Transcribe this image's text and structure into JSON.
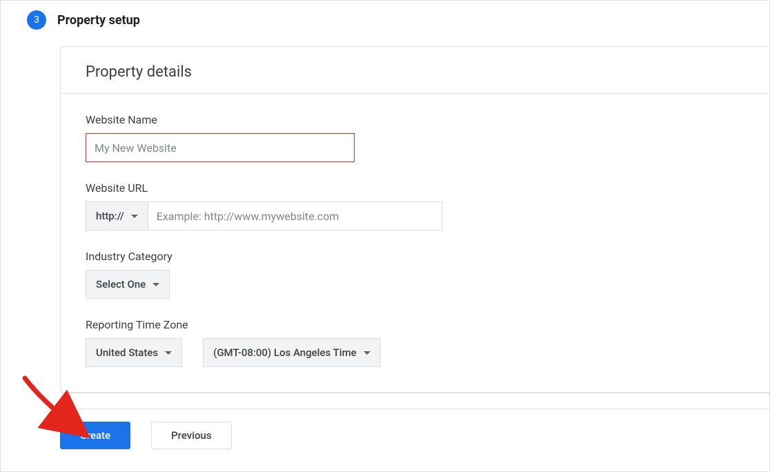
{
  "step": {
    "number": "3",
    "title": "Property setup"
  },
  "card": {
    "header": "Property details",
    "website_name": {
      "label": "Website Name",
      "placeholder": "My New Website",
      "value": ""
    },
    "website_url": {
      "label": "Website URL",
      "protocol": "http://",
      "placeholder": "Example: http://www.mywebsite.com",
      "value": ""
    },
    "industry": {
      "label": "Industry Category",
      "selected": "Select One"
    },
    "timezone": {
      "label": "Reporting Time Zone",
      "country": "United States",
      "zone": "(GMT-08:00) Los Angeles Time"
    }
  },
  "footer": {
    "create": "Create",
    "previous": "Previous"
  }
}
